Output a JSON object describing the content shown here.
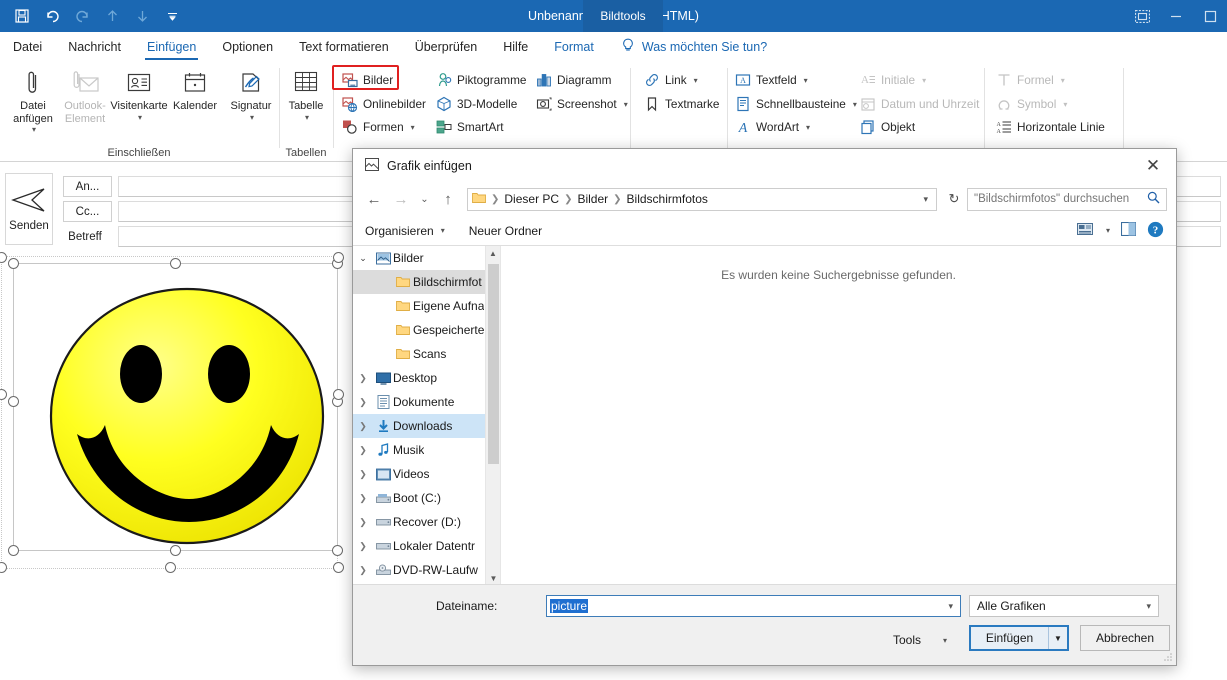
{
  "titlebar": {
    "document_title": "Unbenannt  -  Nachricht (HTML)",
    "contextual_tab": "Bildtools",
    "qat": [
      {
        "name": "save-icon",
        "label": "Speichern"
      },
      {
        "name": "undo-icon",
        "label": "Rückgängig"
      },
      {
        "name": "redo-icon",
        "label": "Wiederholen"
      },
      {
        "name": "up-arrow-icon",
        "label": "Nach oben"
      },
      {
        "name": "down-arrow-icon",
        "label": "Nach unten"
      },
      {
        "name": "qat-more-icon",
        "label": "Symbolleiste anpassen"
      }
    ],
    "window_controls": [
      {
        "name": "ribbon-display-options-icon",
        "glyph": "▭"
      },
      {
        "name": "minimize-icon",
        "glyph": "—"
      },
      {
        "name": "maximize-icon",
        "glyph": "▢"
      }
    ]
  },
  "tabs": [
    {
      "label": "Datei",
      "state": "normal"
    },
    {
      "label": "Nachricht",
      "state": "normal"
    },
    {
      "label": "Einfügen",
      "state": "active"
    },
    {
      "label": "Optionen",
      "state": "normal"
    },
    {
      "label": "Text formatieren",
      "state": "normal"
    },
    {
      "label": "Überprüfen",
      "state": "normal"
    },
    {
      "label": "Hilfe",
      "state": "normal"
    },
    {
      "label": "Format",
      "state": "contextual"
    }
  ],
  "tellme": {
    "label": "Was möchten Sie tun?",
    "icon": "lightbulb-icon"
  },
  "ribbon": {
    "groups": [
      {
        "name": "einschliessen",
        "label": "Einschließen",
        "big_buttons": [
          {
            "label": "Datei anfügen",
            "icon": "paperclip-icon",
            "has_caret": true,
            "disabled": false
          },
          {
            "label": "Outlook-Element",
            "icon": "outlook-item-icon",
            "has_caret": false,
            "disabled": true
          },
          {
            "label": "Visitenkarte",
            "icon": "business-card-icon",
            "has_caret": true,
            "disabled": false
          },
          {
            "label": "Kalender",
            "icon": "calendar-icon",
            "has_caret": false,
            "disabled": false
          },
          {
            "label": "Signatur",
            "icon": "signature-icon",
            "has_caret": true,
            "disabled": false
          }
        ]
      },
      {
        "name": "tabellen",
        "label": "Tabellen",
        "big_buttons": [
          {
            "label": "Tabelle",
            "icon": "table-icon",
            "has_caret": true,
            "disabled": false
          }
        ]
      },
      {
        "name": "illustrationen",
        "label": "",
        "items": [
          {
            "label": "Bilder",
            "icon": "pictures-icon",
            "highlighted": true,
            "disabled": false,
            "has_caret": false
          },
          {
            "label": "Onlinebilder",
            "icon": "online-pictures-icon",
            "disabled": false,
            "has_caret": false
          },
          {
            "label": "Formen",
            "icon": "shapes-icon",
            "disabled": false,
            "has_caret": true
          },
          {
            "label": "Piktogramme",
            "icon": "icons-icon",
            "disabled": false,
            "has_caret": false
          },
          {
            "label": "3D-Modelle",
            "icon": "3d-model-icon",
            "disabled": false,
            "has_caret": false
          },
          {
            "label": "SmartArt",
            "icon": "smartart-icon",
            "disabled": false,
            "has_caret": false
          },
          {
            "label": "Diagramm",
            "icon": "chart-icon",
            "disabled": false,
            "has_caret": false
          },
          {
            "label": "Screenshot",
            "icon": "screenshot-icon",
            "disabled": false,
            "has_caret": true
          }
        ]
      },
      {
        "name": "links",
        "label": "",
        "items": [
          {
            "label": "Link",
            "icon": "link-icon",
            "disabled": false,
            "has_caret": true
          },
          {
            "label": "Textmarke",
            "icon": "bookmark-icon",
            "disabled": false,
            "has_caret": false
          }
        ]
      },
      {
        "name": "text",
        "label": "",
        "items": [
          {
            "label": "Textfeld",
            "icon": "textbox-icon",
            "disabled": false,
            "has_caret": true
          },
          {
            "label": "Schnellbausteine",
            "icon": "quick-parts-icon",
            "disabled": false,
            "has_caret": true
          },
          {
            "label": "WordArt",
            "icon": "wordart-icon",
            "disabled": false,
            "has_caret": true
          },
          {
            "label": "Initiale",
            "icon": "drop-cap-icon",
            "disabled": true,
            "has_caret": true
          },
          {
            "label": "Datum und Uhrzeit",
            "icon": "date-time-icon",
            "disabled": true,
            "has_caret": false
          },
          {
            "label": "Objekt",
            "icon": "object-icon",
            "disabled": false,
            "has_caret": false
          }
        ]
      },
      {
        "name": "symbole",
        "label": "",
        "items": [
          {
            "label": "Formel",
            "icon": "equation-icon",
            "disabled": true,
            "has_caret": true
          },
          {
            "label": "Symbol",
            "icon": "symbol-icon",
            "disabled": true,
            "has_caret": true
          },
          {
            "label": "Horizontale Linie",
            "icon": "horizontal-line-icon",
            "disabled": false,
            "has_caret": false
          }
        ]
      }
    ]
  },
  "compose": {
    "send_label": "Senden",
    "to_label": "An...",
    "cc_label": "Cc...",
    "subject_label": "Betreff",
    "to_value": "",
    "cc_value": "",
    "subject_value": ""
  },
  "mail_body": {
    "image_name": "smiley-face-image",
    "image_alt": "Gelbes Smiley-Gesicht",
    "selected": true
  },
  "dialog": {
    "title": "Grafik einfügen",
    "title_icon": "picture-icon",
    "close_label": "✕",
    "nav": {
      "back": "←",
      "forward": "→",
      "recent": "⌄",
      "up": "↑",
      "breadcrumb": [
        "Dieser PC",
        "Bilder",
        "Bildschirmfotos"
      ],
      "refresh": "↻",
      "search_placeholder": "\"Bildschirmfotos\" durchsuchen",
      "search_value": "",
      "search_icon": "search-icon"
    },
    "toolbar": {
      "organize": "Organisieren",
      "new_folder": "Neuer Ordner",
      "view_icon": "view-layout-icon",
      "preview_pane_icon": "preview-pane-icon",
      "help_icon": "help-icon"
    },
    "tree": [
      {
        "label": "Bilder",
        "icon": "pictures-folder-icon",
        "indent": 0,
        "chevron": "open",
        "state": "normal"
      },
      {
        "label": "Bildschirmfot",
        "icon": "folder-icon",
        "indent": 1,
        "chevron": "none",
        "state": "selected-gray"
      },
      {
        "label": "Eigene Aufna",
        "icon": "folder-icon",
        "indent": 1,
        "chevron": "none",
        "state": "normal"
      },
      {
        "label": "Gespeicherte",
        "icon": "folder-icon",
        "indent": 1,
        "chevron": "none",
        "state": "normal"
      },
      {
        "label": "Scans",
        "icon": "folder-icon",
        "indent": 1,
        "chevron": "none",
        "state": "normal"
      },
      {
        "label": "Desktop",
        "icon": "desktop-icon",
        "indent": 0,
        "chevron": "closed",
        "state": "normal"
      },
      {
        "label": "Dokumente",
        "icon": "documents-icon",
        "indent": 0,
        "chevron": "closed",
        "state": "normal"
      },
      {
        "label": "Downloads",
        "icon": "downloads-icon",
        "indent": 0,
        "chevron": "closed",
        "state": "selected-blue"
      },
      {
        "label": "Musik",
        "icon": "music-icon",
        "indent": 0,
        "chevron": "closed",
        "state": "normal"
      },
      {
        "label": "Videos",
        "icon": "videos-icon",
        "indent": 0,
        "chevron": "closed",
        "state": "normal"
      },
      {
        "label": "Boot (C:)",
        "icon": "drive-icon",
        "indent": 0,
        "chevron": "closed",
        "state": "normal"
      },
      {
        "label": "Recover (D:)",
        "icon": "drive-icon",
        "indent": 0,
        "chevron": "closed",
        "state": "normal"
      },
      {
        "label": "Lokaler Datentr",
        "icon": "drive-icon",
        "indent": 0,
        "chevron": "closed",
        "state": "normal"
      },
      {
        "label": "DVD-RW-Laufw",
        "icon": "dvd-drive-icon",
        "indent": 0,
        "chevron": "closed",
        "state": "normal"
      }
    ],
    "file_list": {
      "empty_message": "Es wurden keine Suchergebnisse gefunden."
    },
    "bottom": {
      "filename_label": "Dateiname:",
      "filename_value": "picture",
      "filename_selected": true,
      "filter_value": "Alle Grafiken",
      "tools_label": "Tools",
      "insert_label": "Einfügen",
      "cancel_label": "Abbrechen"
    }
  },
  "colors": {
    "titlebar": "#1b68b3",
    "contextual_tab": "#1a5fa3",
    "accent": "#1b68b3",
    "highlight_red": "#e02020",
    "selection_blue": "#1f6fd0",
    "tree_selected": "#cde4f7",
    "smiley_yellow": "#ffff00"
  }
}
